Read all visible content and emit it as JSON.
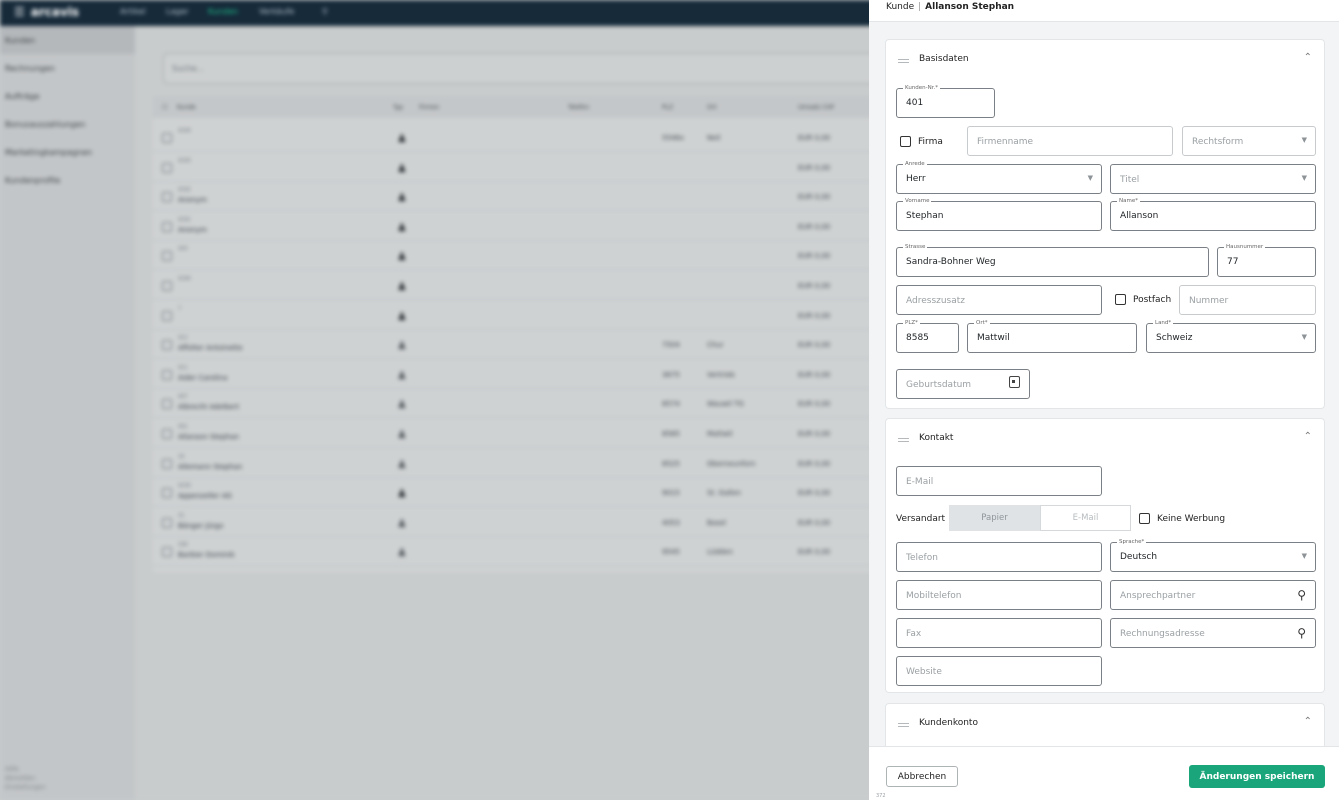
{
  "background": {
    "logo": "arcavis",
    "nav": [
      "Artikel",
      "Lager",
      "Kunden",
      "Verkäufe"
    ],
    "sidebar": [
      "Kunden",
      "Rechnungen",
      "Aufträge",
      "Bonusauszahlungen",
      "Marketingkampagnen",
      "Kundenprofile"
    ],
    "sidebar_footer": [
      "Hilfe",
      "Abmelden",
      "Einstellungen"
    ],
    "search_placeholder": "Suche...",
    "table_headers": [
      "Kunde",
      "Typ",
      "Firmen",
      "Telefon",
      "PLZ",
      "Ort",
      "Umsatz CHF"
    ],
    "rows": [
      {
        "sub": "4194",
        "name": "",
        "plz": "5546x",
        "ort": "Neil",
        "amt": "EUR 0,00"
      },
      {
        "sub": "4193",
        "name": "",
        "plz": "",
        "ort": "",
        "amt": "EUR 0,00"
      },
      {
        "sub": "4192",
        "name": "Anonym",
        "plz": "",
        "ort": "",
        "amt": "EUR 0,00"
      },
      {
        "sub": "4191",
        "name": "Anonym",
        "plz": "",
        "ort": "",
        "amt": "EUR 0,00"
      },
      {
        "sub": "420",
        "name": "",
        "plz": "",
        "ort": "",
        "amt": "EUR 0,00"
      },
      {
        "sub": "4190",
        "name": "",
        "plz": "",
        "ort": "",
        "amt": "EUR 0,00"
      },
      {
        "sub": "7",
        "name": "",
        "plz": "",
        "ort": "",
        "amt": "EUR 0,00"
      },
      {
        "sub": "412",
        "name": "Affolter Antoinette",
        "plz": "7504",
        "ort": "Chur",
        "amt": "EUR 0,00"
      },
      {
        "sub": "411",
        "name": "Aider Carolina",
        "plz": "3675",
        "ort": "Vertrieb",
        "amt": "EUR 0,00"
      },
      {
        "sub": "407",
        "name": "Albrecht Adelbert",
        "plz": "8574",
        "ort": "Wauwil TG",
        "amt": "EUR 0,00"
      },
      {
        "sub": "401",
        "name": "Allanson Stephan",
        "plz": "8585",
        "ort": "Mattwil",
        "amt": "EUR 0,00"
      },
      {
        "sub": "16",
        "name": "Allemann Stephan",
        "plz": "8525",
        "ort": "Oberneunforn",
        "amt": "EUR 0,00"
      },
      {
        "sub": "4230",
        "name": "Appenzeller AG",
        "plz": "9015",
        "ort": "St. Gallen",
        "amt": "EUR 0,00"
      },
      {
        "sub": "31",
        "name": "Bänger Jürgo",
        "plz": "4053",
        "ort": "Basel",
        "amt": "EUR 0,00"
      },
      {
        "sub": "338",
        "name": "Barbier Dominik",
        "plz": "9545",
        "ort": "Lüdden",
        "amt": "EUR 0,00"
      }
    ]
  },
  "panel": {
    "breadcrumb_root": "Kunde",
    "breadcrumb_sep": "|",
    "breadcrumb_current": "Allanson Stephan",
    "basisdaten": {
      "title": "Basisdaten",
      "kundennr_label": "Kunden-Nr.*",
      "kundennr_value": "401",
      "firma_label": "Firma",
      "firmenname_placeholder": "Firmenname",
      "rechtsform_placeholder": "Rechtsform",
      "anrede_label": "Anrede",
      "anrede_value": "Herr",
      "titel_placeholder": "Titel",
      "vorname_label": "Vorname",
      "vorname_value": "Stephan",
      "name_label": "Name*",
      "name_value": "Allanson",
      "strasse_label": "Strasse",
      "strasse_value": "Sandra-Bohner Weg",
      "hausnummer_label": "Hausnummer",
      "hausnummer_value": "77",
      "adresszusatz_placeholder": "Adresszusatz",
      "postfach_label": "Postfach",
      "nummer_placeholder": "Nummer",
      "plz_label": "PLZ*",
      "plz_value": "8585",
      "ort_label": "Ort*",
      "ort_value": "Mattwil",
      "land_label": "Land*",
      "land_value": "Schweiz",
      "geburtsdatum_placeholder": "Geburtsdatum"
    },
    "kontakt": {
      "title": "Kontakt",
      "email_placeholder": "E-Mail",
      "versandart_label": "Versandart",
      "versandart_options": [
        "Papier",
        "E-Mail"
      ],
      "keine_werbung_label": "Keine Werbung",
      "telefon_placeholder": "Telefon",
      "sprache_label": "Sprache*",
      "sprache_value": "Deutsch",
      "mobiltelefon_placeholder": "Mobiltelefon",
      "ansprechpartner_placeholder": "Ansprechpartner",
      "fax_placeholder": "Fax",
      "rechnungsadresse_placeholder": "Rechnungsadresse",
      "website_placeholder": "Website"
    },
    "kundenkonto": {
      "title": "Kundenkonto"
    },
    "footer": {
      "cancel_label": "Abbrechen",
      "save_label": "Änderungen speichern",
      "version": "372"
    }
  }
}
